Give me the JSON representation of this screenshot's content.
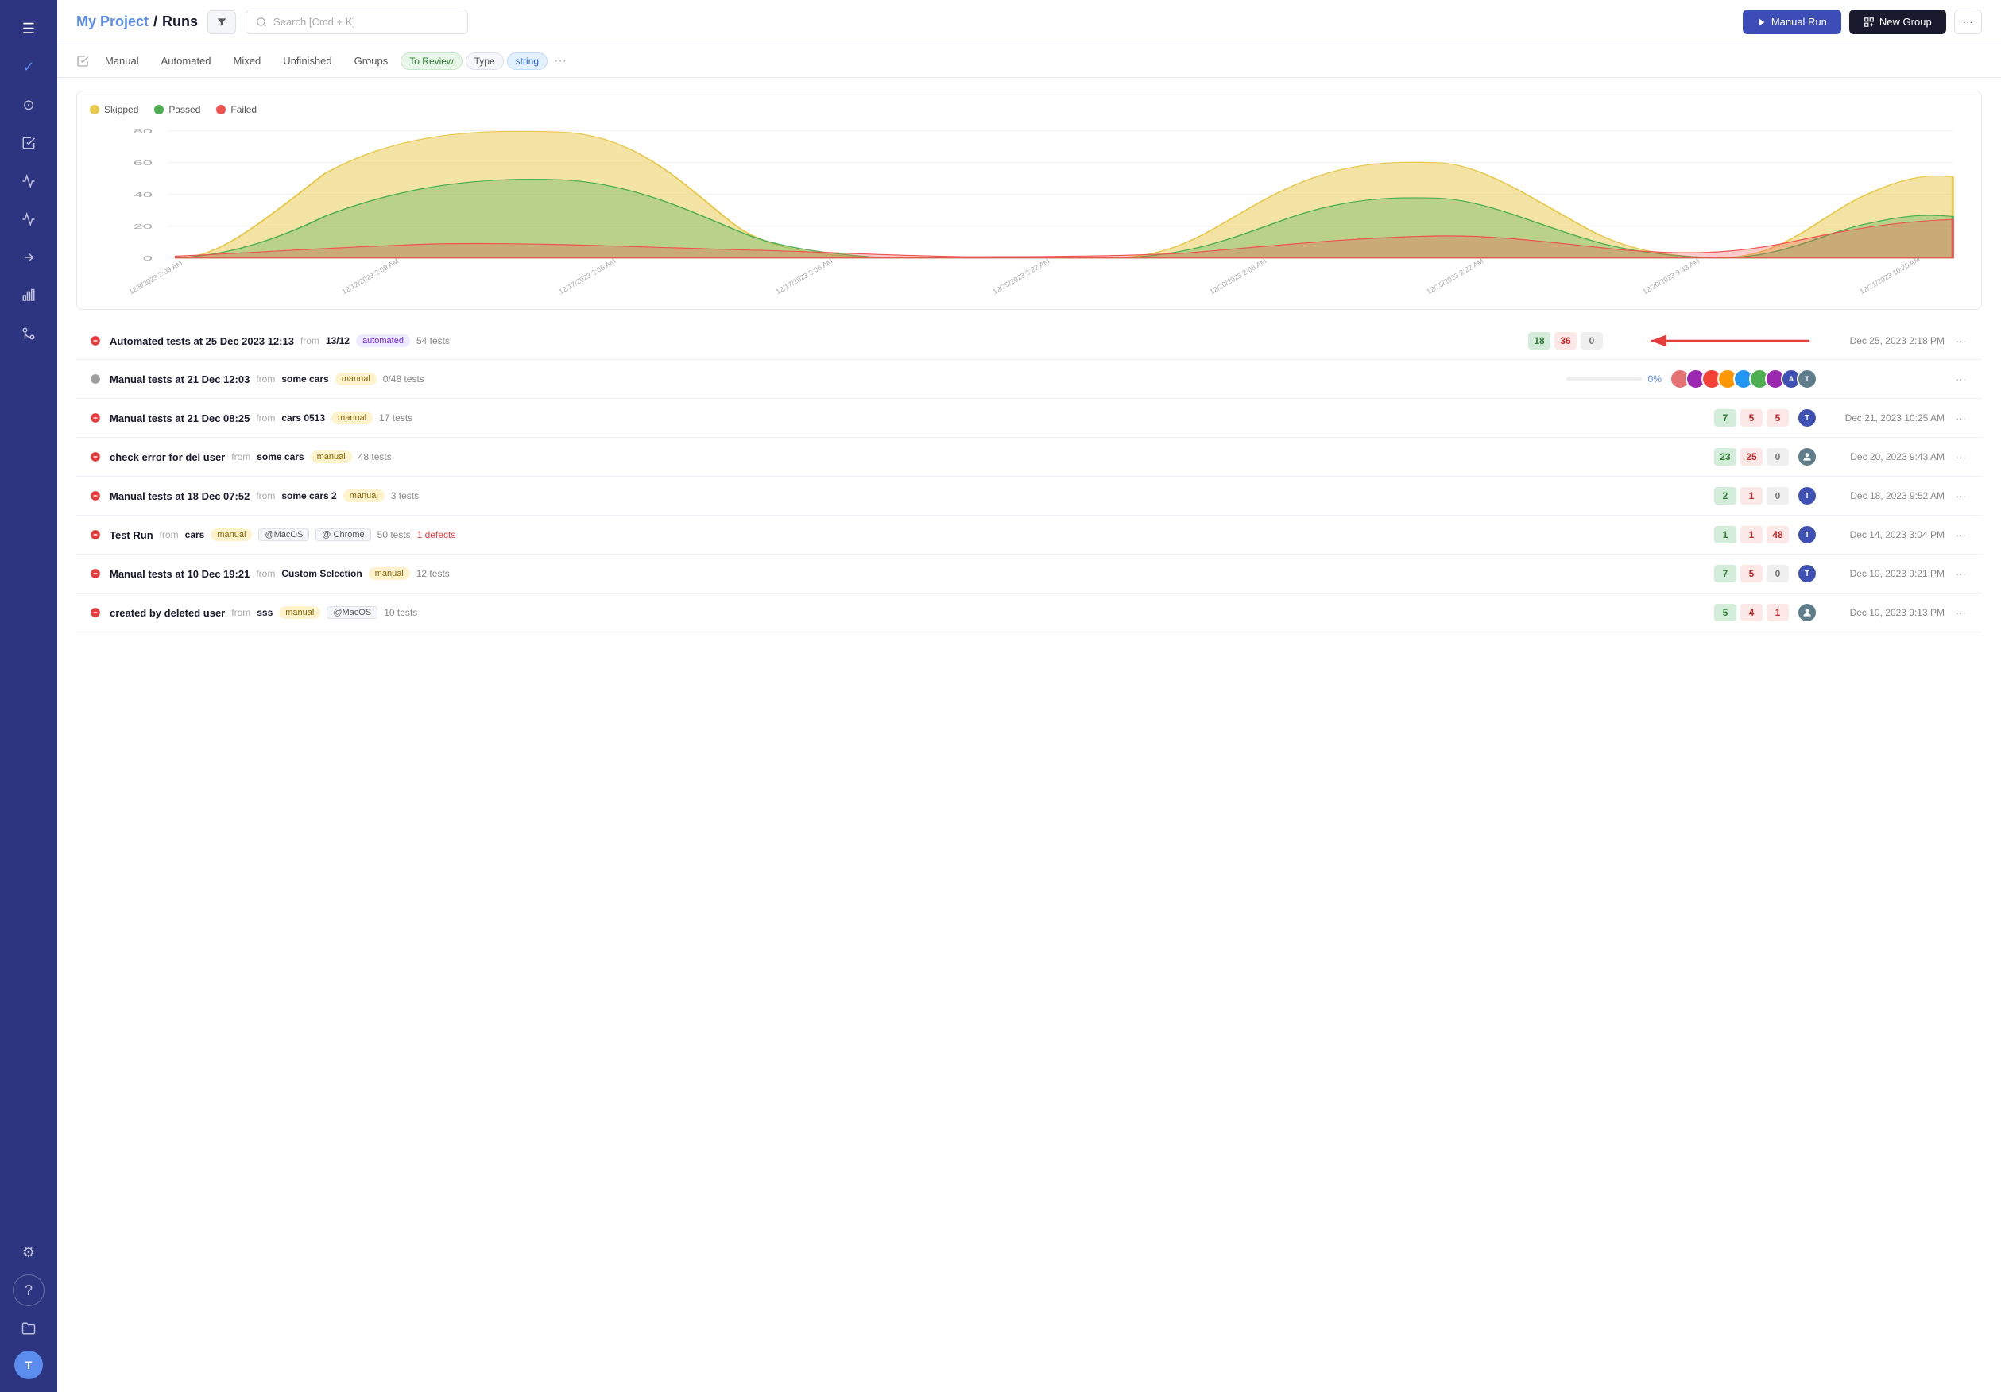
{
  "sidebar": {
    "avatar_label": "T",
    "icons": [
      {
        "name": "hamburger-icon",
        "symbol": "☰"
      },
      {
        "name": "check-icon",
        "symbol": "✓"
      },
      {
        "name": "play-circle-icon",
        "symbol": "⊙"
      },
      {
        "name": "list-check-icon",
        "symbol": "✔"
      },
      {
        "name": "chart-line-icon",
        "symbol": "↗"
      },
      {
        "name": "activity-icon",
        "symbol": "∿"
      },
      {
        "name": "export-icon",
        "symbol": "⬔"
      },
      {
        "name": "bar-chart-icon",
        "symbol": "▦"
      },
      {
        "name": "git-icon",
        "symbol": "⑂"
      },
      {
        "name": "settings-icon",
        "symbol": "⚙"
      },
      {
        "name": "help-icon",
        "symbol": "?"
      },
      {
        "name": "folder-icon",
        "symbol": "📁"
      }
    ]
  },
  "header": {
    "project_label": "My Project",
    "separator": "/",
    "page_title": "Runs",
    "search_placeholder": "Search [Cmd + K]",
    "btn_manual_run": "Manual Run",
    "btn_new_group": "New Group"
  },
  "tabs": {
    "items": [
      {
        "label": "Manual",
        "active": false
      },
      {
        "label": "Automated",
        "active": false
      },
      {
        "label": "Mixed",
        "active": false
      },
      {
        "label": "Unfinished",
        "active": false
      },
      {
        "label": "Groups",
        "active": false
      }
    ],
    "badges": [
      {
        "label": "To Review",
        "type": "green"
      },
      {
        "label": "Type",
        "type": "gray"
      },
      {
        "label": "string",
        "type": "blue"
      }
    ]
  },
  "chart": {
    "legend": [
      {
        "label": "Skipped",
        "color": "#e8c94e"
      },
      {
        "label": "Passed",
        "color": "#4caf50"
      },
      {
        "label": "Failed",
        "color": "#ef5350"
      }
    ],
    "y_labels": [
      "0",
      "20",
      "40",
      "60",
      "80"
    ],
    "x_labels": [
      "12/8/2023 2:09 AM",
      "12/12/2023 2:09 AM",
      "12/17/2023 2:05 AM",
      "12/17/2023 2:06 AM",
      "12/25/2023 2:22 AM",
      "12/20/2023 2:06 AM",
      "12/25/2023 2:22 AM",
      "12/20/2023 9:43 AM",
      "12/21/2023 10:25 AM"
    ]
  },
  "runs": [
    {
      "id": 1,
      "status": "failed",
      "title": "Automated tests at 25 Dec 2023 12:13",
      "from_label": "from",
      "from_value": "13/12",
      "type": "automated",
      "count": "54 tests",
      "stats": [
        {
          "val": "18",
          "type": "green"
        },
        {
          "val": "36",
          "type": "red"
        },
        {
          "val": "0",
          "type": "gray"
        }
      ],
      "has_arrow": true,
      "date": "Dec 25, 2023 2:18 PM",
      "avatars": []
    },
    {
      "id": 2,
      "status": "pending",
      "title": "Manual tests at 21 Dec 12:03",
      "from_label": "from",
      "from_value": "some cars",
      "type": "manual",
      "count": "0/48 tests",
      "progress": 0,
      "date": "",
      "avatars": [
        "#e57373",
        "#9c27b0",
        "#f44336",
        "#ff9800",
        "#2196f3",
        "#4caf50",
        "#9c27b0",
        "#3f51b5"
      ]
    },
    {
      "id": 3,
      "status": "failed",
      "title": "Manual tests at 21 Dec 08:25",
      "from_label": "from",
      "from_value": "cars 0513",
      "type": "manual",
      "count": "17 tests",
      "stats": [
        {
          "val": "7",
          "type": "green"
        },
        {
          "val": "5",
          "type": "red"
        },
        {
          "val": "5",
          "type": "red"
        }
      ],
      "date": "Dec 21, 2023 10:25 AM",
      "avatars": [
        "#3f51b5"
      ]
    },
    {
      "id": 4,
      "status": "failed",
      "title": "check error for del user",
      "from_label": "from",
      "from_value": "some cars",
      "type": "manual",
      "count": "48 tests",
      "stats": [
        {
          "val": "23",
          "type": "green"
        },
        {
          "val": "25",
          "type": "red"
        },
        {
          "val": "0",
          "type": "gray"
        }
      ],
      "date": "Dec 20, 2023 9:43 AM",
      "avatars": [
        "#607d8b"
      ]
    },
    {
      "id": 5,
      "status": "failed",
      "title": "Manual tests at 18 Dec 07:52",
      "from_label": "from",
      "from_value": "some cars 2",
      "type": "manual",
      "count": "3 tests",
      "stats": [
        {
          "val": "2",
          "type": "green"
        },
        {
          "val": "1",
          "type": "red"
        },
        {
          "val": "0",
          "type": "gray"
        }
      ],
      "date": "Dec 18, 2023 9:52 AM",
      "avatars": [
        "#3f51b5"
      ]
    },
    {
      "id": 6,
      "status": "failed",
      "title": "Test Run",
      "from_label": "from",
      "from_value": "cars",
      "type": "manual",
      "count": "50 tests",
      "defects": "1 defects",
      "tags": [
        "@MacOS",
        "@ Chrome"
      ],
      "stats": [
        {
          "val": "1",
          "type": "green"
        },
        {
          "val": "1",
          "type": "red"
        },
        {
          "val": "48",
          "type": "red"
        }
      ],
      "date": "Dec 14, 2023 3:04 PM",
      "avatars": [
        "#3f51b5"
      ]
    },
    {
      "id": 7,
      "status": "failed",
      "title": "Manual tests at 10 Dec 19:21",
      "from_label": "from",
      "from_value": "Custom Selection",
      "type": "manual",
      "count": "12 tests",
      "stats": [
        {
          "val": "7",
          "type": "green"
        },
        {
          "val": "5",
          "type": "red"
        },
        {
          "val": "0",
          "type": "gray"
        }
      ],
      "date": "Dec 10, 2023 9:21 PM",
      "avatars": [
        "#3f51b5"
      ]
    },
    {
      "id": 8,
      "status": "failed",
      "title": "created by deleted user",
      "from_label": "from",
      "from_value": "sss",
      "type": "manual",
      "count": "10 tests",
      "tags": [
        "@MacOS"
      ],
      "stats": [
        {
          "val": "5",
          "type": "green"
        },
        {
          "val": "4",
          "type": "red"
        },
        {
          "val": "1",
          "type": "red"
        }
      ],
      "date": "Dec 10, 2023 9:13 PM",
      "avatars": [
        "#607d8b"
      ]
    }
  ]
}
